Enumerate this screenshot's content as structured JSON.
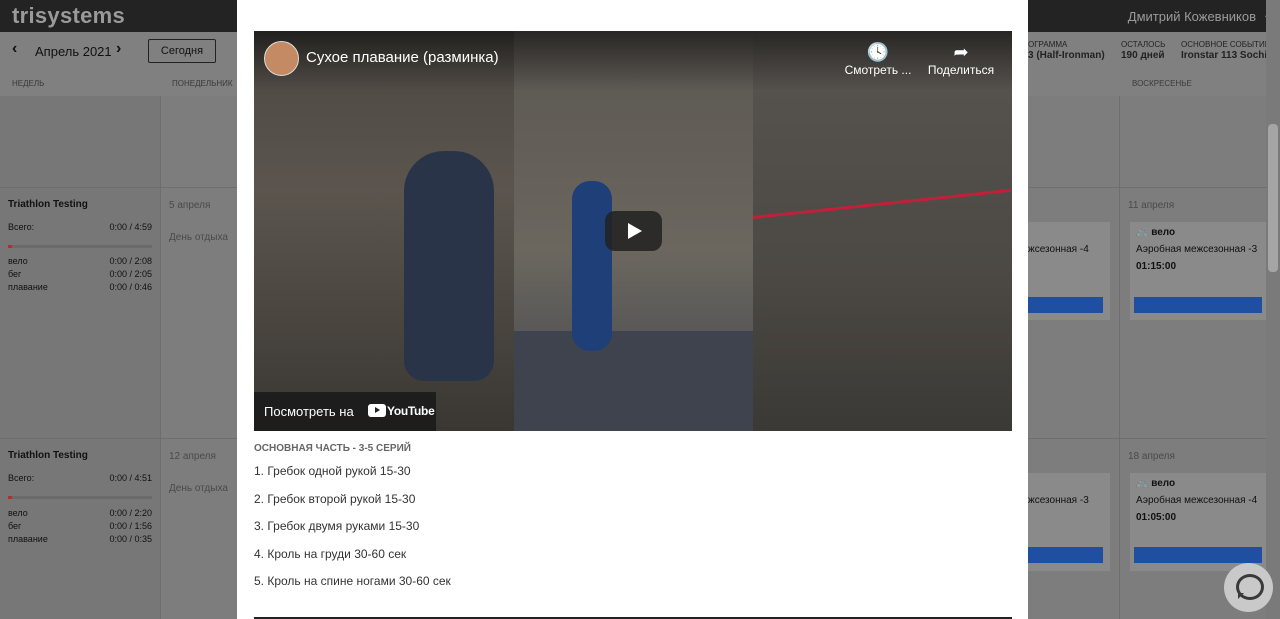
{
  "app": {
    "logo": "trisystems",
    "user_name": "Дмитрий Кожевников",
    "month_label": "Апрель 2021",
    "today_button": "Сегодня",
    "stats": [
      {
        "label": "ОГРАММА",
        "value": "3 (Half-Ironman)"
      },
      {
        "label": "ОСТАЛОСЬ",
        "value": "190 дней"
      },
      {
        "label": "ОСНОВНОЕ СОБЫТИЕ",
        "value": "Ironstar 113 Sochi"
      }
    ],
    "day_headers": [
      "НЕДЕЛЬ",
      "ПОНЕДЕЛЬНИК",
      "ВОСКРЕСЕНЬЕ"
    ]
  },
  "weeks": [
    {
      "title": "Triathlon Testing",
      "total_label": "Всего:",
      "total_value": "0:00 / 4:59",
      "progress": 0.03,
      "rows": [
        {
          "label": "вело",
          "value": "0:00 / 2:08"
        },
        {
          "label": "бег",
          "value": "0:00 / 2:05"
        },
        {
          "label": "плавание",
          "value": "0:00 / 0:46"
        }
      ],
      "monday_date": "5 апреля",
      "monday_note": "День отдыха",
      "partial_card_text": "жсезонная -4",
      "sunday_date": "11 апреля",
      "sunday_card": {
        "sport": "вело",
        "name": "Аэробная межсезонная -3",
        "time": "01:15:00"
      }
    },
    {
      "title": "Triathlon Testing",
      "total_label": "Всего:",
      "total_value": "0:00 / 4:51",
      "progress": 0.03,
      "rows": [
        {
          "label": "вело",
          "value": "0:00 / 2:20"
        },
        {
          "label": "бег",
          "value": "0:00 / 1:56"
        },
        {
          "label": "плавание",
          "value": "0:00 / 0:35"
        }
      ],
      "monday_date": "12 апреля",
      "monday_note": "День отдыха",
      "partial_card_text": "жсезонная -3",
      "sunday_date": "18 апреля",
      "sunday_card": {
        "sport": "вело",
        "name": "Аэробная межсезонная -4",
        "time": "01:05:00"
      }
    }
  ],
  "modal": {
    "video": {
      "title": "Сухое плавание (разминка)",
      "watch_later": "Смотреть ...",
      "share": "Поделиться",
      "watch_on": "Посмотреть на",
      "brand": "YouTube"
    },
    "section_title": "ОСНОВНАЯ ЧАСТЬ - 3-5 СЕРИЙ",
    "items": [
      "1. Гребок одной рукой 15-30",
      "2. Гребок второй рукой 15-30",
      "3. Гребок двумя руками 15-30",
      "4. Кроль на груди 30-60 сек",
      "5. Кроль на спине ногами 30-60 сек"
    ]
  },
  "icons": {
    "watch_later": "clock-icon",
    "share": "share-icon",
    "play": "play-icon",
    "bike": "bike-icon",
    "chat": "chat-icon"
  }
}
